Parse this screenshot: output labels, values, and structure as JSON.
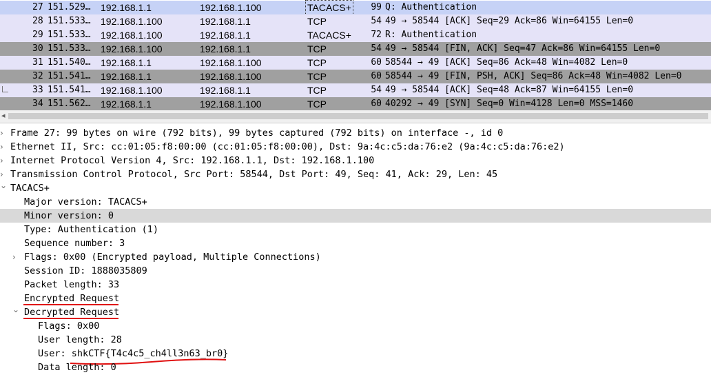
{
  "packets": [
    {
      "no": "27",
      "time": "151.529…",
      "src": "192.168.1.1",
      "dst": "192.168.1.100",
      "proto": "TACACS+",
      "len": "99",
      "info": "Q: Authentication",
      "style": "row-sel"
    },
    {
      "no": "28",
      "time": "151.533…",
      "src": "192.168.1.100",
      "dst": "192.168.1.1",
      "proto": "TCP",
      "len": "54",
      "info": "49 → 58544 [ACK] Seq=29 Ack=86 Win=64155 Len=0",
      "style": "row-ack"
    },
    {
      "no": "29",
      "time": "151.533…",
      "src": "192.168.1.100",
      "dst": "192.168.1.1",
      "proto": "TACACS+",
      "len": "72",
      "info": "R: Authentication",
      "style": "row-tacacs"
    },
    {
      "no": "30",
      "time": "151.533…",
      "src": "192.168.1.100",
      "dst": "192.168.1.1",
      "proto": "TCP",
      "len": "54",
      "info": "49 → 58544 [FIN, ACK] Seq=47 Ack=86 Win=64155 Len=0",
      "style": "row-gray"
    },
    {
      "no": "31",
      "time": "151.540…",
      "src": "192.168.1.1",
      "dst": "192.168.1.100",
      "proto": "TCP",
      "len": "60",
      "info": "58544 → 49 [ACK] Seq=86 Ack=48 Win=4082 Len=0",
      "style": "row-ack"
    },
    {
      "no": "32",
      "time": "151.541…",
      "src": "192.168.1.1",
      "dst": "192.168.1.100",
      "proto": "TCP",
      "len": "60",
      "info": "58544 → 49 [FIN, PSH, ACK] Seq=86 Ack=48 Win=4082 Len=0",
      "style": "row-gray"
    },
    {
      "no": "33",
      "time": "151.541…",
      "src": "192.168.1.100",
      "dst": "192.168.1.1",
      "proto": "TCP",
      "len": "54",
      "info": "49 → 58544 [ACK] Seq=48 Ack=87 Win=64155 Len=0",
      "style": "row-ack"
    },
    {
      "no": "34",
      "time": "151.562…",
      "src": "192.168.1.1",
      "dst": "192.168.1.100",
      "proto": "TCP",
      "len": "60",
      "info": "40292 → 49 [SYN] Seq=0 Win=4128 Len=0 MSS=1460",
      "style": "row-gray"
    }
  ],
  "details": [
    {
      "text": "Frame 27: 99 bytes on wire (792 bits), 99 bytes captured (792 bits) on interface -, id 0",
      "indent": 0,
      "chevron": "right"
    },
    {
      "text": "Ethernet II, Src: cc:01:05:f8:00:00 (cc:01:05:f8:00:00), Dst: 9a:4c:c5:da:76:e2 (9a:4c:c5:da:76:e2)",
      "indent": 0,
      "chevron": "right"
    },
    {
      "text": "Internet Protocol Version 4, Src: 192.168.1.1, Dst: 192.168.1.100",
      "indent": 0,
      "chevron": "right"
    },
    {
      "text": "Transmission Control Protocol, Src Port: 58544, Dst Port: 49, Seq: 41, Ack: 29, Len: 45",
      "indent": 0,
      "chevron": "right"
    },
    {
      "text": "TACACS+",
      "indent": 0,
      "chevron": "down"
    },
    {
      "text": "Major version: TACACS+",
      "indent": 1,
      "chevron": ""
    },
    {
      "text": "Minor version: 0",
      "indent": 1,
      "chevron": "",
      "highlight": true
    },
    {
      "text": "Type: Authentication (1)",
      "indent": 1,
      "chevron": ""
    },
    {
      "text": "Sequence number: 3",
      "indent": 1,
      "chevron": ""
    },
    {
      "text": "Flags: 0x00 (Encrypted payload, Multiple Connections)",
      "indent": 1,
      "chevron": "right"
    },
    {
      "text": "Session ID: 1888035809",
      "indent": 1,
      "chevron": ""
    },
    {
      "text": "Packet length: 33",
      "indent": 1,
      "chevron": ""
    },
    {
      "text": "Encrypted Request",
      "indent": 1,
      "chevron": "",
      "underline": true
    },
    {
      "text": "Decrypted Request",
      "indent": 1,
      "chevron": "down",
      "underline": true
    },
    {
      "text": "Flags: 0x00",
      "indent": 2,
      "chevron": ""
    },
    {
      "text": "User length: 28",
      "indent": 2,
      "chevron": ""
    },
    {
      "text": "User: shkCTF{T4c4c5_ch4ll3n63_br0}",
      "indent": 2,
      "chevron": "",
      "curve": true
    },
    {
      "text": "Data length: 0",
      "indent": 2,
      "chevron": ""
    }
  ],
  "colors": {
    "selected": "#c6d2f6",
    "tacacs": "#e5e3f8",
    "gray": "#a0a0a0",
    "highlight": "#d9d9d9",
    "annotation": "#e01010"
  }
}
